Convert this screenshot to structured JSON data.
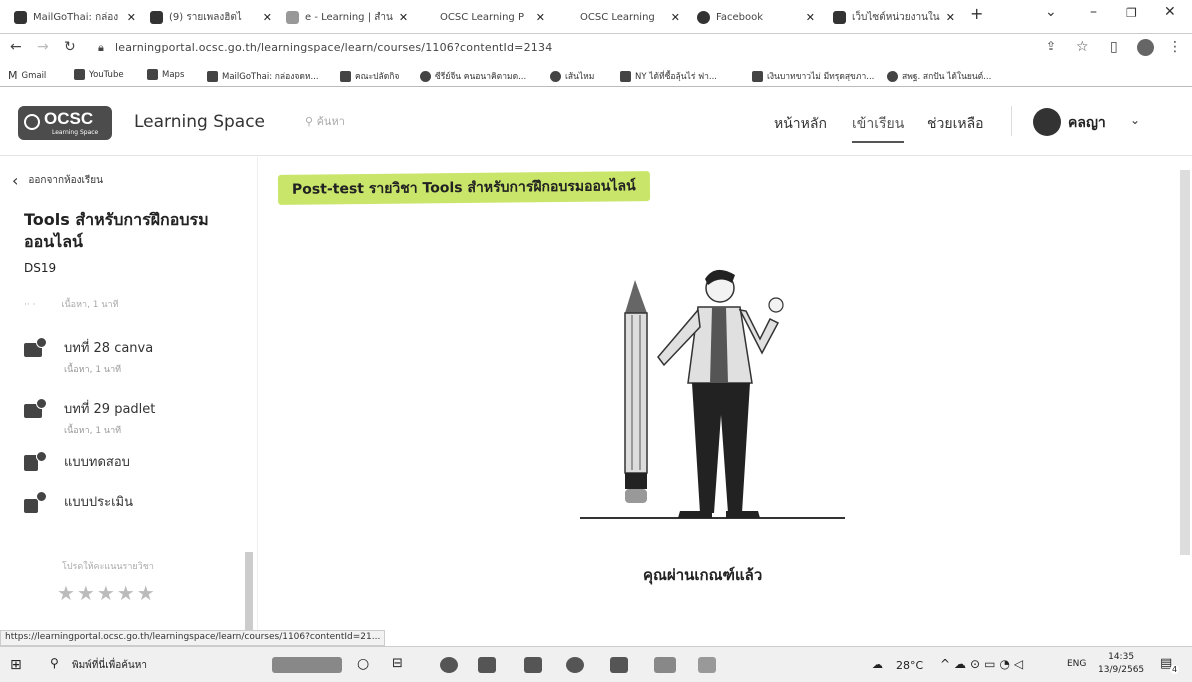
{
  "browser": {
    "tabs": [
      {
        "label": "MailGoThai: กล่อง",
        "close": "✕"
      },
      {
        "label": "(9) รายเพลงฮิตไ",
        "close": "✕"
      },
      {
        "label": "e - Learning | สำน",
        "close": "✕"
      },
      {
        "label": "OCSC Learning P",
        "close": "✕"
      },
      {
        "label": "OCSC Learning",
        "close": "✕"
      },
      {
        "label": "Facebook",
        "close": "✕"
      },
      {
        "label": "เว็บไซต์หน่วยงานใน",
        "close": "✕"
      }
    ],
    "new_tab": "+",
    "window_controls": {
      "chevron": "⌄",
      "minimize": "–",
      "maximize": "❐",
      "close": "✕"
    },
    "url": "learningportal.ocsc.go.th/learningspace/learn/courses/1106?contentId=2134",
    "bookmarks": [
      "Gmail",
      "YouTube",
      "Maps",
      "MailGoThai: กล่องจดห...",
      "คณะปลัดกิจ",
      "ซีรีย์จีน คนอนาคิตามด...",
      "เส้นไหม",
      "NY ได้ที่ซื้อลุ้นไร่ ฟา...",
      "เงินบาทขาวไม่ มีทรุดสุขภา...",
      "สพฐ. สกปัน ได้ในยนต์..."
    ]
  },
  "site": {
    "logo_text": "OCSC",
    "logo_sub": "Learning Space",
    "name": "Learning Space",
    "search_placeholder": "ค้นหา",
    "nav": {
      "home": "หน้าหลัก",
      "learn": "เข้าเรียน",
      "help": "ช่วยเหลือ"
    },
    "user": "คลญา",
    "user_chevron": "⌄"
  },
  "sidebar": {
    "back_icon": "‹",
    "back_label": "ออกจากห้องเรียน",
    "course_title": "Tools สำหรับการฝึกอบรมออนไลน์",
    "course_code": "DS19",
    "cut_item_meta": "เนื้อหา, 1 นาที",
    "lessons": [
      {
        "name": "บทที่ 28 canva",
        "meta": "เนื้อหา, 1 นาที"
      },
      {
        "name": "บทที่ 29 padlet",
        "meta": "เนื้อหา, 1 นาที"
      },
      {
        "name": "แบบทดสอบ",
        "meta": ""
      },
      {
        "name": "แบบประเมิน",
        "meta": ""
      }
    ],
    "rating_label": "โปรดให้คะแนนรายวิชา",
    "stars": "★★★★★"
  },
  "main": {
    "post_test_title": "Post-test รายวิชา Tools สำหรับการฝึกอบรมออนไลน์",
    "result_text": "คุณผ่านเกณฑ์แล้ว"
  },
  "status_url": "https://learningportal.ocsc.go.th/learningspace/learn/courses/1106?contentId=21...",
  "taskbar": {
    "search_placeholder": "พิมพ์ที่นี่เพื่อค้นหา",
    "temperature": "28°C",
    "language": "ENG",
    "time": "14:35",
    "date": "13/9/2565",
    "notification_count": "4"
  }
}
